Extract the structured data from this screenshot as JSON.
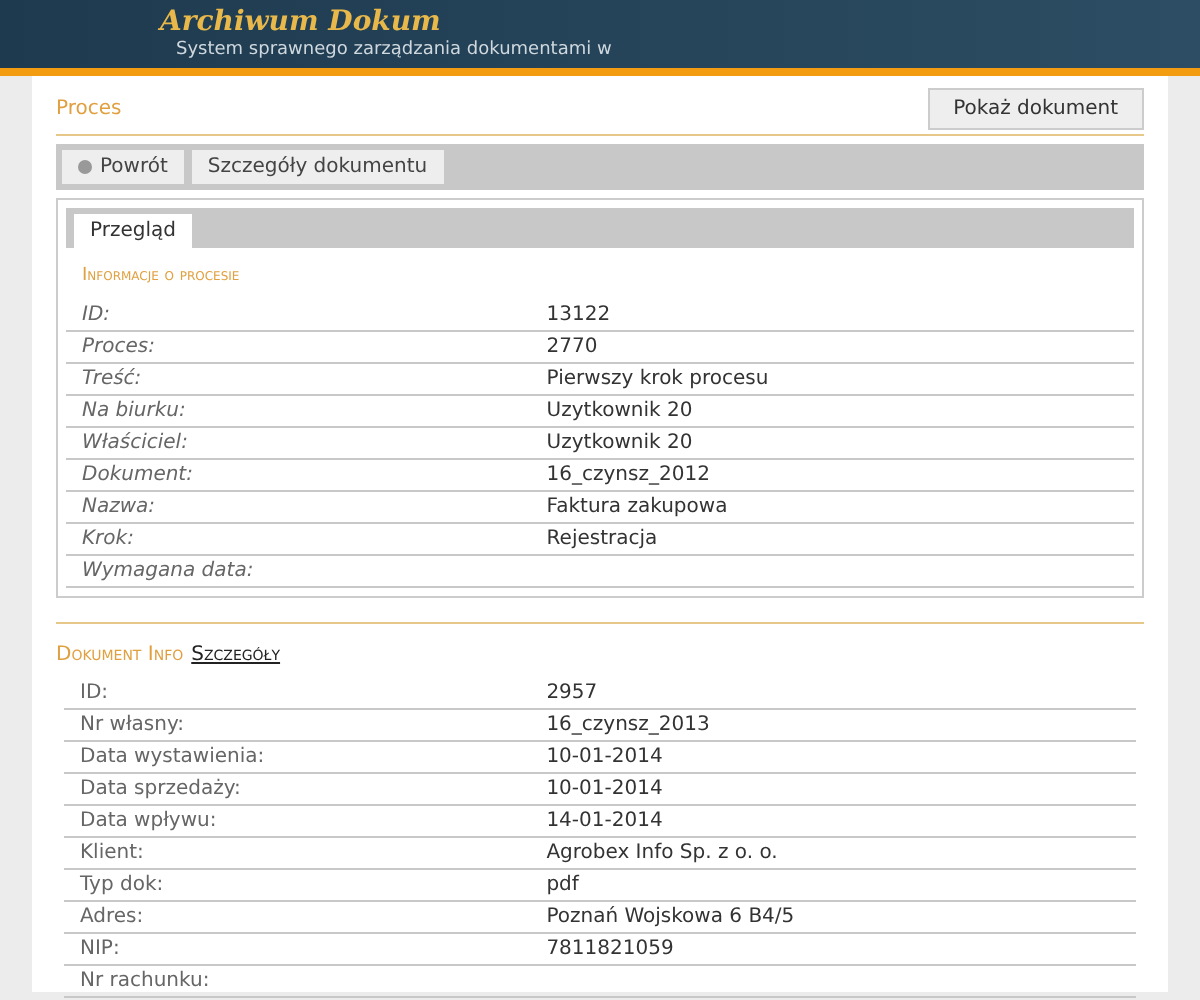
{
  "header": {
    "title": "Archiwum Dokum",
    "subtitle": "System sprawnego zarządzania dokumentami w"
  },
  "process": {
    "title": "Proces",
    "show_button": "Pokaż dokument",
    "toolbar": [
      {
        "label": "Powrót",
        "kind": "back"
      },
      {
        "label": "Szczegóły dokumentu",
        "kind": "plain"
      }
    ],
    "tabs": [
      {
        "label": "Przegląd",
        "selected": true
      }
    ],
    "section_title": "Informacje o procesie",
    "rows": [
      {
        "label": "ID:",
        "value": "13122"
      },
      {
        "label": "Proces:",
        "value": "2770"
      },
      {
        "label": "Treść:",
        "value": "Pierwszy krok procesu"
      },
      {
        "label": "Na biurku:",
        "value": "Uzytkownik 20"
      },
      {
        "label": "Właściciel:",
        "value": "Uzytkownik 20"
      },
      {
        "label": "Dokument:",
        "value": "16_czynsz_2012"
      },
      {
        "label": "Nazwa:",
        "value": "Faktura zakupowa"
      },
      {
        "label": "Krok:",
        "value": "Rejestracja"
      },
      {
        "label": "Wymagana data:",
        "value": ""
      }
    ]
  },
  "document": {
    "title": "Dokument Info",
    "link": "Szczegóły",
    "rows": [
      {
        "label": "ID:",
        "value": "2957"
      },
      {
        "label": "Nr własny:",
        "value": "16_czynsz_2013"
      },
      {
        "label": "Data wystawienia:",
        "value": "10-01-2014"
      },
      {
        "label": "Data sprzedaży:",
        "value": "10-01-2014"
      },
      {
        "label": "Data wpływu:",
        "value": "14-01-2014"
      },
      {
        "label": "Klient:",
        "value": "Agrobex Info Sp. z o. o."
      },
      {
        "label": "Typ dok:",
        "value": "pdf"
      },
      {
        "label": "Adres:",
        "value": "Poznań Wojskowa 6 B4/5"
      },
      {
        "label": "NIP:",
        "value": "7811821059"
      },
      {
        "label": "Nr rachunku:",
        "value": ""
      }
    ]
  }
}
